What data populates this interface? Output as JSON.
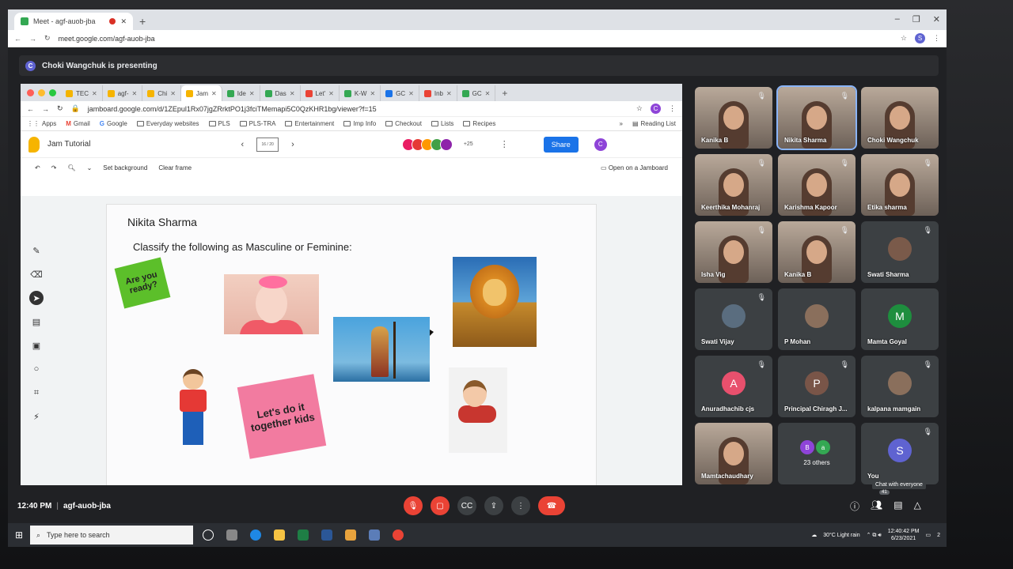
{
  "outer_browser": {
    "tab_title": "Meet - agf-auob-jba",
    "url": "meet.google.com/agf-auob-jba",
    "profile_initial": "S"
  },
  "presenting": {
    "initial": "C",
    "text": "Choki Wangchuk is presenting"
  },
  "inner_browser": {
    "tabs": [
      {
        "label": "TEC",
        "color": "#f4b400"
      },
      {
        "label": "agf-",
        "color": "#f6b400"
      },
      {
        "label": "Chi",
        "color": "#f6b400"
      },
      {
        "label": "Jam",
        "color": "#f6b400"
      },
      {
        "label": "Ide",
        "color": "#34a853"
      },
      {
        "label": "Das",
        "color": "#34a853"
      },
      {
        "label": "Let'",
        "color": "#ea4335"
      },
      {
        "label": "K-W",
        "color": "#34a853"
      },
      {
        "label": "GC",
        "color": "#1a73e8"
      },
      {
        "label": "Inb",
        "color": "#ea4335"
      },
      {
        "label": "GC",
        "color": "#34a853"
      }
    ],
    "url": "jamboard.google.com/d/1ZEpul1Rx07jgZRrktPO1j3fciTMemapi5C0QzKHR1bg/viewer?f=15",
    "profile_initial": "C",
    "bookmarks": [
      "Apps",
      "Gmail",
      "Google",
      "Everyday websites",
      "PLS",
      "PLS-TRA",
      "Entertainment",
      "Imp Info",
      "Checkout",
      "Lists",
      "Recipes"
    ],
    "reading_list": "Reading List"
  },
  "jamboard": {
    "title": "Jam Tutorial",
    "frame_indicator": "16 / 20",
    "collaborators_extra": "+25",
    "share_label": "Share",
    "user_initial": "C",
    "toolbar": {
      "set_background": "Set background",
      "clear_frame": "Clear frame",
      "open_on_jamboard": "Open on a Jamboard"
    },
    "frame": {
      "author": "Nikita Sharma",
      "task": "Classify  the following as Masculine or Feminine:",
      "sticky_green": "Are you ready?",
      "sticky_pink": "Let's do it together kids"
    },
    "collaborator_colors": [
      "#e91e63",
      "#e53935",
      "#ff9800",
      "#43a047",
      "#8e24aa"
    ]
  },
  "participants": [
    {
      "name": "Kanika B",
      "type": "video",
      "muted": true
    },
    {
      "name": "Nikita Sharma",
      "type": "video",
      "muted": true
    },
    {
      "name": "Choki Wangchuk",
      "type": "video",
      "muted": false
    },
    {
      "name": "Keerthika Mohanraj",
      "type": "video",
      "muted": true
    },
    {
      "name": "Karishma Kapoor",
      "type": "video",
      "muted": true
    },
    {
      "name": "Etika sharma",
      "type": "video",
      "muted": true
    },
    {
      "name": "Isha Vig",
      "type": "video",
      "muted": true
    },
    {
      "name": "Kanika B",
      "type": "video",
      "muted": true
    },
    {
      "name": "Swati Sharma",
      "type": "photo",
      "muted": true
    },
    {
      "name": "Swati Vijay",
      "type": "photo",
      "muted": true
    },
    {
      "name": "P Mohan",
      "type": "photo",
      "muted": false
    },
    {
      "name": "Mamta Goyal",
      "type": "avatar",
      "initial": "M",
      "color": "#1e8e3e",
      "muted": false
    },
    {
      "name": "Anuradhachib cjs",
      "type": "avatar",
      "initial": "A",
      "color": "#e8506d",
      "muted": true
    },
    {
      "name": "Principal Chiragh J...",
      "type": "avatar",
      "initial": "P",
      "color": "#795548",
      "muted": true
    },
    {
      "name": "kalpana mamgain",
      "type": "photo",
      "muted": true
    },
    {
      "name": "Mamtachaudhary",
      "type": "video",
      "muted": false
    },
    {
      "name": "23 others",
      "type": "others",
      "muted": false
    },
    {
      "name": "You",
      "type": "avatar",
      "initial": "S",
      "color": "#5f63d1",
      "muted": true
    }
  ],
  "others_initials": [
    "B",
    "a"
  ],
  "meeting": {
    "time": "12:40 PM",
    "code": "agf-auob-jba",
    "tooltip": "Chat with everyone",
    "people_count": "41"
  },
  "taskbar": {
    "search_placeholder": "Type here to search",
    "weather": "30°C  Light rain",
    "time": "12:40:42 PM",
    "date": "6/23/2021",
    "notifications": "2"
  }
}
